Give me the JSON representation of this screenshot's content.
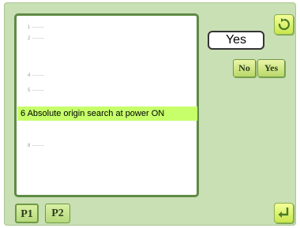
{
  "list": {
    "items": [
      {
        "label": "1 ------"
      },
      {
        "label": "2 ------"
      },
      {
        "label": "4 ------"
      },
      {
        "label": "5 ------"
      },
      {
        "label": "6 Absolute origin search at power ON",
        "selected": true
      },
      {
        "label": "8 ------"
      }
    ]
  },
  "value": {
    "current": "Yes"
  },
  "buttons": {
    "no": "No",
    "yes": "Yes"
  },
  "tabs": [
    {
      "label": "P1"
    },
    {
      "label": "P2"
    }
  ],
  "icons": {
    "top": "reset-arrow-icon",
    "bottom": "return-arrow-icon"
  },
  "colors": {
    "selected_highlight": "#c6ff6a",
    "panel_border": "#5f8a45",
    "screen_bg": "#c9dfb4"
  }
}
